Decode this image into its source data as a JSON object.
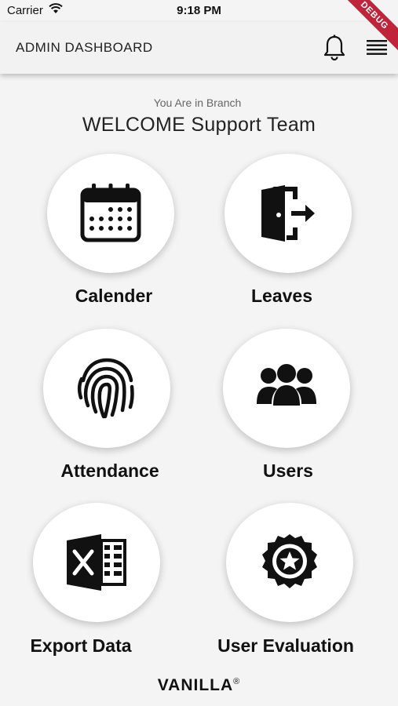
{
  "status_bar": {
    "carrier": "Carrier",
    "time": "9:18 PM",
    "debug_badge": "DEBUG"
  },
  "app_bar": {
    "title": "ADMIN DASHBOARD",
    "icons": [
      "bell-icon",
      "menu-icon"
    ]
  },
  "header": {
    "branch_label": "You Are in Branch",
    "welcome": "WELCOME Support Team"
  },
  "tiles": [
    {
      "label": "Calender",
      "icon": "calendar-icon"
    },
    {
      "label": "Leaves",
      "icon": "door-exit-icon"
    },
    {
      "label": "Attendance",
      "icon": "fingerprint-icon"
    },
    {
      "label": "Users",
      "icon": "users-group-icon"
    },
    {
      "label": "Export Data",
      "icon": "excel-icon"
    },
    {
      "label": "User Evaluation",
      "icon": "star-badge-icon"
    }
  ],
  "footer": {
    "brand": "VANILLA",
    "registered_mark": "®"
  },
  "colors": {
    "background": "#f4f4f4",
    "card": "#ffffff",
    "text": "#111111",
    "debug_ribbon": "#c0243a"
  }
}
